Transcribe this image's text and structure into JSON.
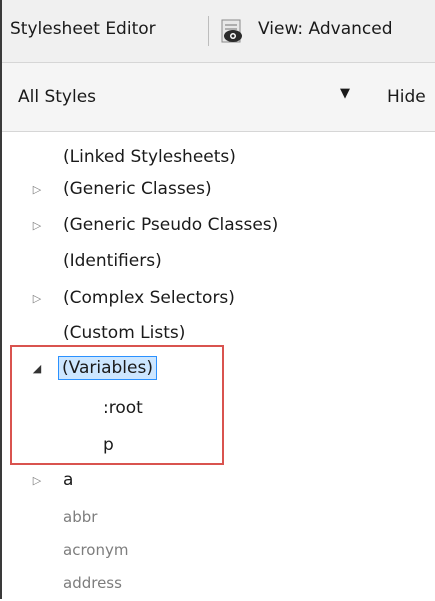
{
  "toolbar": {
    "title": "Stylesheet Editor",
    "view_label": "View: Advanced",
    "view_icon": "eye-icon"
  },
  "filter": {
    "selected": "All Styles",
    "hide_label": "Hide",
    "caret_icon": "dropdown-caret-icon"
  },
  "tree": {
    "items": [
      {
        "label": "(Linked Stylesheets)",
        "expander": "none"
      },
      {
        "label": "(Generic Classes)",
        "expander": "collapsed"
      },
      {
        "label": "(Generic Pseudo Classes)",
        "expander": "collapsed"
      },
      {
        "label": "(Identifiers)",
        "expander": "none"
      },
      {
        "label": "(Complex Selectors)",
        "expander": "collapsed"
      },
      {
        "label": "(Custom Lists)",
        "expander": "none"
      },
      {
        "label": "(Variables)",
        "expander": "expanded",
        "selected": true
      },
      {
        "label": ":root",
        "expander": "none"
      },
      {
        "label": "p",
        "expander": "none"
      },
      {
        "label": "a",
        "expander": "collapsed"
      },
      {
        "label": "abbr",
        "expander": "none"
      },
      {
        "label": "acronym",
        "expander": "none"
      },
      {
        "label": "address",
        "expander": "none"
      }
    ]
  },
  "colors": {
    "highlight_box": "#d9534f",
    "selection_border": "#2b91ff",
    "selection_fill": "#cce6ff"
  }
}
